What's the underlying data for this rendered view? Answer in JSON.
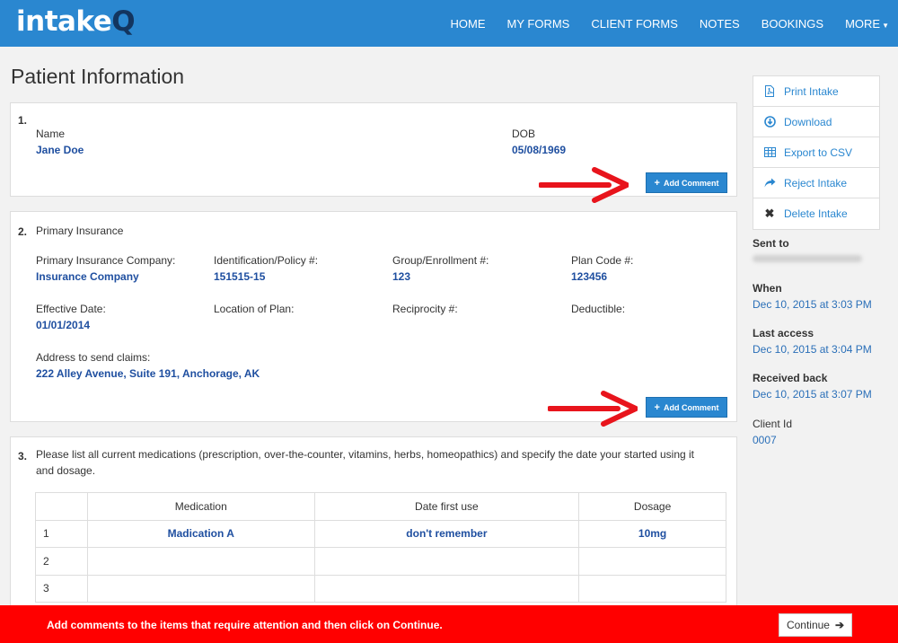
{
  "nav": {
    "logo_main": "intake",
    "logo_accent": "Q",
    "links": [
      "HOME",
      "MY FORMS",
      "CLIENT FORMS",
      "NOTES",
      "BOOKINGS",
      "MORE"
    ]
  },
  "page_title": "Patient Information",
  "add_comment_label": "Add Comment",
  "q1": {
    "number": "1.",
    "name_label": "Name",
    "name_value": "Jane Doe",
    "dob_label": "DOB",
    "dob_value": "05/08/1969"
  },
  "q2": {
    "number": "2.",
    "title": "Primary Insurance",
    "fields": [
      {
        "label": "Primary Insurance Company:",
        "value": "Insurance Company"
      },
      {
        "label": "Identification/Policy #:",
        "value": "151515-15"
      },
      {
        "label": "Group/Enrollment #:",
        "value": "123"
      },
      {
        "label": "Plan Code #:",
        "value": "123456"
      },
      {
        "label": "Effective Date:",
        "value": "01/01/2014"
      },
      {
        "label": "Location of Plan:",
        "value": ""
      },
      {
        "label": "Reciprocity #:",
        "value": ""
      },
      {
        "label": "Deductible:",
        "value": ""
      },
      {
        "label": "Address to send claims:",
        "value": "222 Alley Avenue, Suite 191, Anchorage, AK"
      }
    ]
  },
  "q3": {
    "number": "3.",
    "text_line1": "Please list all current medications (prescription, over-the-counter, vitamins, herbs, homeopathics) and specify the date your started using it",
    "text_line2": "and dosage.",
    "columns": [
      "Medication",
      "Date first use",
      "Dosage"
    ],
    "rows": [
      {
        "index": "1",
        "medication": "Madication A",
        "date": "don't remember",
        "dosage": "10mg"
      },
      {
        "index": "2",
        "medication": "",
        "date": "",
        "dosage": ""
      },
      {
        "index": "3",
        "medication": "",
        "date": "",
        "dosage": ""
      }
    ]
  },
  "sidebar": {
    "actions": [
      "Print Intake",
      "Download",
      "Export to CSV",
      "Reject Intake",
      "Delete Intake"
    ],
    "sent_to_label": "Sent to",
    "when_label": "When",
    "when_value": "Dec 10, 2015 at 3:03 PM",
    "last_access_label": "Last access",
    "last_access_value": "Dec 10, 2015 at 3:04 PM",
    "received_label": "Received back",
    "received_value": "Dec 10, 2015 at 3:07 PM",
    "client_id_label": "Client Id",
    "client_id_value": "0007"
  },
  "footer": {
    "message": "Add comments to the items that require attention and then click on Continue.",
    "continue_label": "Continue"
  },
  "colors": {
    "brand_blue": "#2a87d0",
    "logo_accent": "#13355f",
    "value_text": "#1f4fa0",
    "alert_red": "#ff0000",
    "arrow_red": "#e8141c"
  }
}
